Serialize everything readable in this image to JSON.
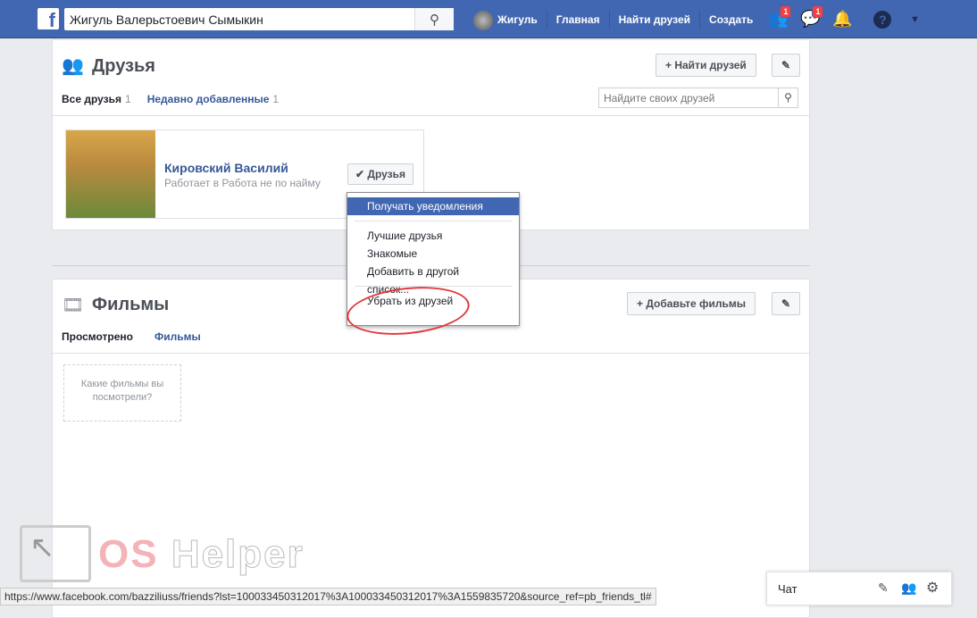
{
  "topbar": {
    "search_value": "Жигуль Валерьстоевич Сымыкин",
    "user": "Жигуль",
    "nav": [
      "Главная",
      "Найти друзей",
      "Создать"
    ],
    "friend_requests_badge": "1",
    "messages_badge": "1"
  },
  "friends": {
    "title": "Друзья",
    "find_button": "Найти друзей",
    "tabs": [
      {
        "label": "Все друзья",
        "count": "1"
      },
      {
        "label": "Недавно добавленные",
        "count": "1"
      }
    ],
    "search_placeholder": "Найдите своих друзей",
    "card": {
      "name": "Кировский Василий",
      "subtitle": "Работает в Работа не по найму",
      "button": "Друзья"
    }
  },
  "menu": {
    "items": [
      "Получать уведомления",
      "Лучшие друзья",
      "Знакомые",
      "Добавить в другой список...",
      "Убрать из друзей"
    ]
  },
  "films": {
    "title": "Фильмы",
    "add_button": "Добавьте фильмы",
    "tabs": [
      "Просмотрено",
      "Фильмы"
    ],
    "placeholder_text": "Какие фильмы вы посмотрели?"
  },
  "watermark": "OS Helper",
  "status_url": "https://www.facebook.com/bazziliuss/friends?lst=100033450312017%3A100033450312017%3A1559835720&source_ref=pb_friends_tl#",
  "chat": {
    "label": "Чат"
  },
  "colors": {
    "brand": "#4267b2",
    "highlight": "#e0393e"
  }
}
